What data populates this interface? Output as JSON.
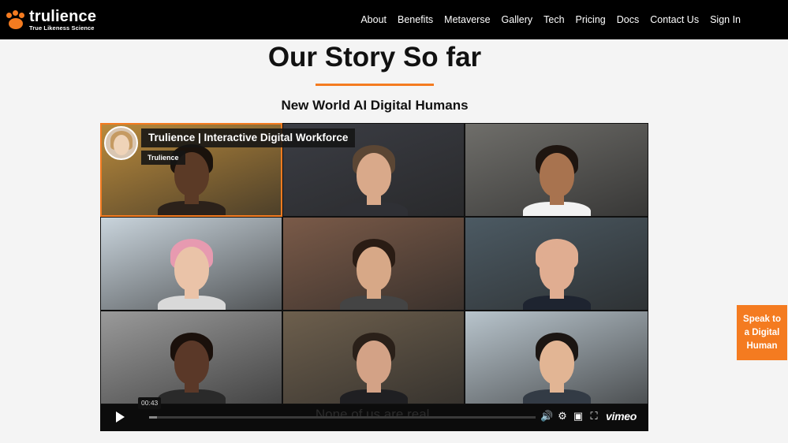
{
  "brand": {
    "name": "trulience",
    "tagline": "True Likeness Science",
    "accent": "#f47b20"
  },
  "nav": {
    "items": [
      {
        "label": "About"
      },
      {
        "label": "Benefits"
      },
      {
        "label": "Metaverse"
      },
      {
        "label": "Gallery"
      },
      {
        "label": "Tech"
      },
      {
        "label": "Pricing"
      },
      {
        "label": "Docs"
      },
      {
        "label": "Contact Us"
      },
      {
        "label": "Sign In"
      }
    ]
  },
  "hero": {
    "title": "Our Story So far",
    "subtitle": "New World AI Digital Humans"
  },
  "video": {
    "title": "Trulience | Interactive Digital Workforce",
    "channel": "Trulience",
    "caption": "None of us are real.",
    "time": "00:43",
    "progress": 0.02,
    "player_brand": "vimeo",
    "tiles": [
      {
        "name": "avatar-man-dreadlocks",
        "bg": "#b98a3c",
        "skin": "#5b3a26",
        "hair": "#1a120c",
        "shirt": "#2b211a"
      },
      {
        "name": "avatar-man-short-hair",
        "bg": "#3b3d44",
        "skin": "#d9a98a",
        "hair": "#5b4634",
        "shirt": "#2f3035"
      },
      {
        "name": "avatar-woman-dark-hair",
        "bg": "#6f6e6a",
        "skin": "#a8734f",
        "hair": "#1e1510",
        "shirt": "#f2f2f2"
      },
      {
        "name": "avatar-woman-pink-hair",
        "bg": "#c9d4dc",
        "skin": "#eac3a8",
        "hair": "#e79ab0",
        "shirt": "#d9d9d9"
      },
      {
        "name": "avatar-woman-brown-hair",
        "bg": "#7a5a48",
        "skin": "#d7a887",
        "hair": "#2a1c14",
        "shirt": "#444"
      },
      {
        "name": "avatar-man-bald",
        "bg": "#4c5a63",
        "skin": "#e0ad91",
        "hair": "#e0ad91",
        "shirt": "#1e2430"
      },
      {
        "name": "avatar-woman-short-hair",
        "bg": "#9a9a9a",
        "skin": "#5a3828",
        "hair": "#1a100b",
        "shirt": "#2a2a2a"
      },
      {
        "name": "avatar-man-dark-suit",
        "bg": "#6d5f4d",
        "skin": "#d3a286",
        "hair": "#2a2019",
        "shirt": "#1f1f22"
      },
      {
        "name": "avatar-man-asian",
        "bg": "#b8c4cc",
        "skin": "#e2b594",
        "hair": "#1b1512",
        "shirt": "#333b45"
      }
    ]
  },
  "cta": {
    "label_line1": "Speak to",
    "label_line2": "a Digital",
    "label_line3": "Human"
  }
}
